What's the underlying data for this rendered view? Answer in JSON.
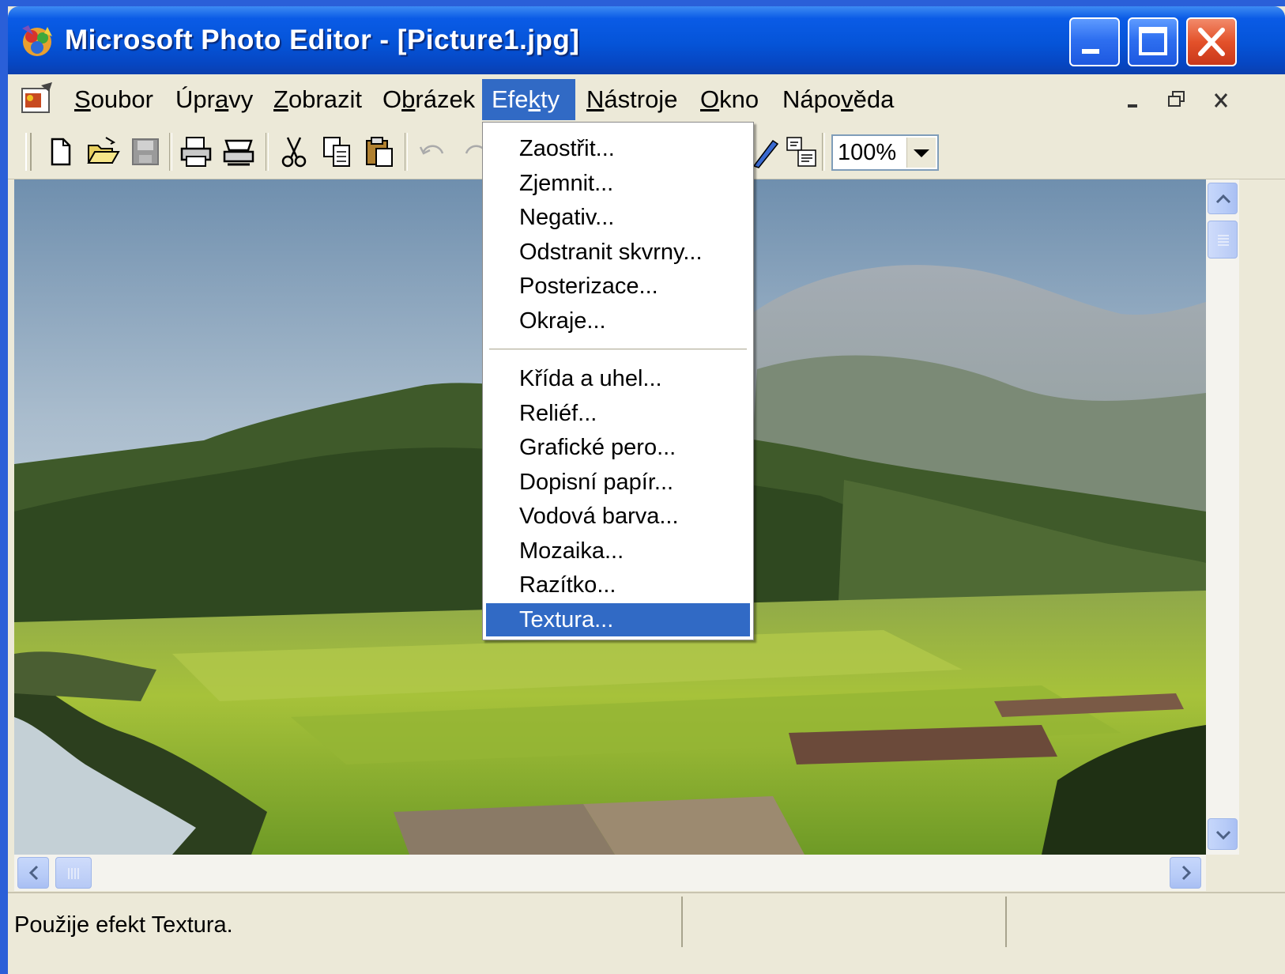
{
  "window": {
    "title": "Microsoft Photo Editor - [Picture1.jpg]"
  },
  "menubar": {
    "items": [
      {
        "label": "Soubor",
        "accel": "S",
        "before": "",
        "after": "oubor"
      },
      {
        "label": "Úpravy",
        "before": "Úpr",
        "accel": "a",
        "after": "vy"
      },
      {
        "label": "Zobrazit",
        "before": "",
        "accel": "Z",
        "after": "obrazit"
      },
      {
        "label": "Obrázek",
        "before": "O",
        "accel": "b",
        "after": "rázek"
      },
      {
        "label": "Efekty",
        "before": "Efe",
        "accel": "k",
        "after": "ty"
      },
      {
        "label": "Nástroje",
        "before": "",
        "accel": "N",
        "after": "ástroje"
      },
      {
        "label": "Okno",
        "before": "",
        "accel": "O",
        "after": "kno"
      },
      {
        "label": "Nápověda",
        "before": "Nápo",
        "accel": "v",
        "after": "ěda"
      }
    ],
    "active_menu": "Efekty",
    "mdi_controls": [
      "minimize-icon",
      "restore-icon",
      "close-icon"
    ]
  },
  "toolbar": {
    "tools": [
      "new-icon",
      "open-icon",
      "save-icon",
      "print-icon",
      "scan-icon",
      "cut-icon",
      "copy-icon",
      "paste-icon",
      "undo-icon",
      "redo-icon",
      "pen-icon",
      "resize-icon"
    ],
    "zoom_value": "100%"
  },
  "effects_menu": {
    "group1": [
      "Zaostřit...",
      "Zjemnit...",
      "Negativ...",
      "Odstranit skvrny...",
      "Posterizace...",
      "Okraje..."
    ],
    "group2": [
      "Křída a uhel...",
      "Reliéf...",
      "Grafické pero...",
      "Dopisní papír...",
      "Vodová barva...",
      "Mozaika...",
      "Razítko...",
      "Textura..."
    ],
    "selected": "Textura..."
  },
  "statusbar": {
    "text": "Použije efekt Textura."
  },
  "colors": {
    "titlebar": "#0554d8",
    "menu_highlight": "#316ac5",
    "chrome": "#ece9d8",
    "close_button": "#e3512a"
  }
}
